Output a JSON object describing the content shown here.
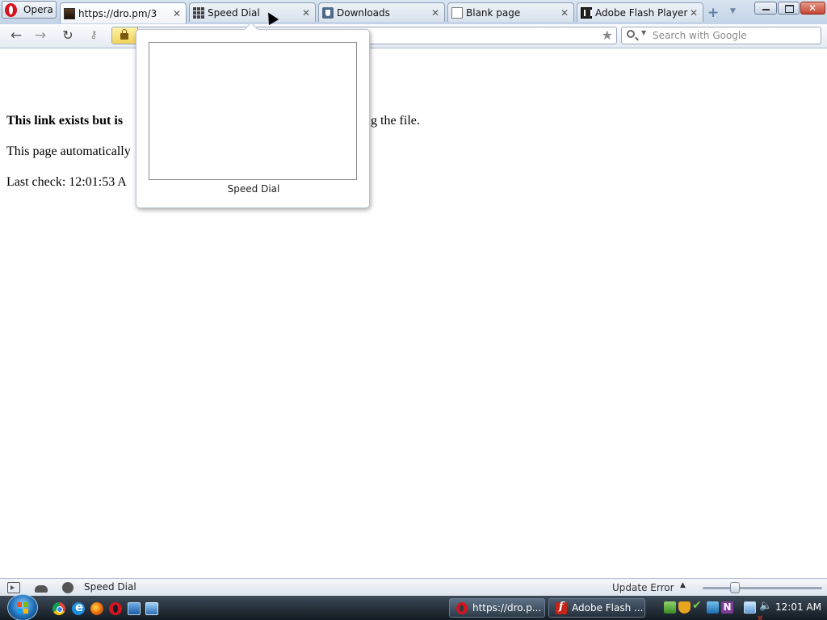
{
  "browser": {
    "menu_label": "Opera",
    "tabs": [
      {
        "label": "https://dro.pm/3",
        "icon": "site-favicon-icon"
      },
      {
        "label": "Speed Dial",
        "icon": "speed-dial-grid-icon"
      },
      {
        "label": "Downloads",
        "icon": "downloads-icon"
      },
      {
        "label": "Blank page",
        "icon": "blank-page-icon"
      },
      {
        "label": "Adobe Flash Player ...",
        "icon": "flash-favicon-icon"
      }
    ],
    "active_tab_index": 0,
    "search_placeholder": "Search with Google"
  },
  "page": {
    "line1_bold": "This link exists but is",
    "line1_rest": "g the file.",
    "line2": "This page automatically",
    "line3": "Last check: 12:01:53 A"
  },
  "tab_preview": {
    "label": "Speed Dial"
  },
  "statusbar": {
    "panel_label": "Speed Dial",
    "update_text": "Update Error"
  },
  "taskbar": {
    "tasks": [
      {
        "label": "https://dro.p...",
        "icon": "opera-icon"
      },
      {
        "label": "Adobe Flash ...",
        "icon": "flash-icon"
      }
    ],
    "tray_letter": "N",
    "clock": "12:01 AM"
  },
  "colors": {
    "opera_red": "#d4141f",
    "window_close_red": "#c44530",
    "taskbar_dark": "#141b22"
  }
}
